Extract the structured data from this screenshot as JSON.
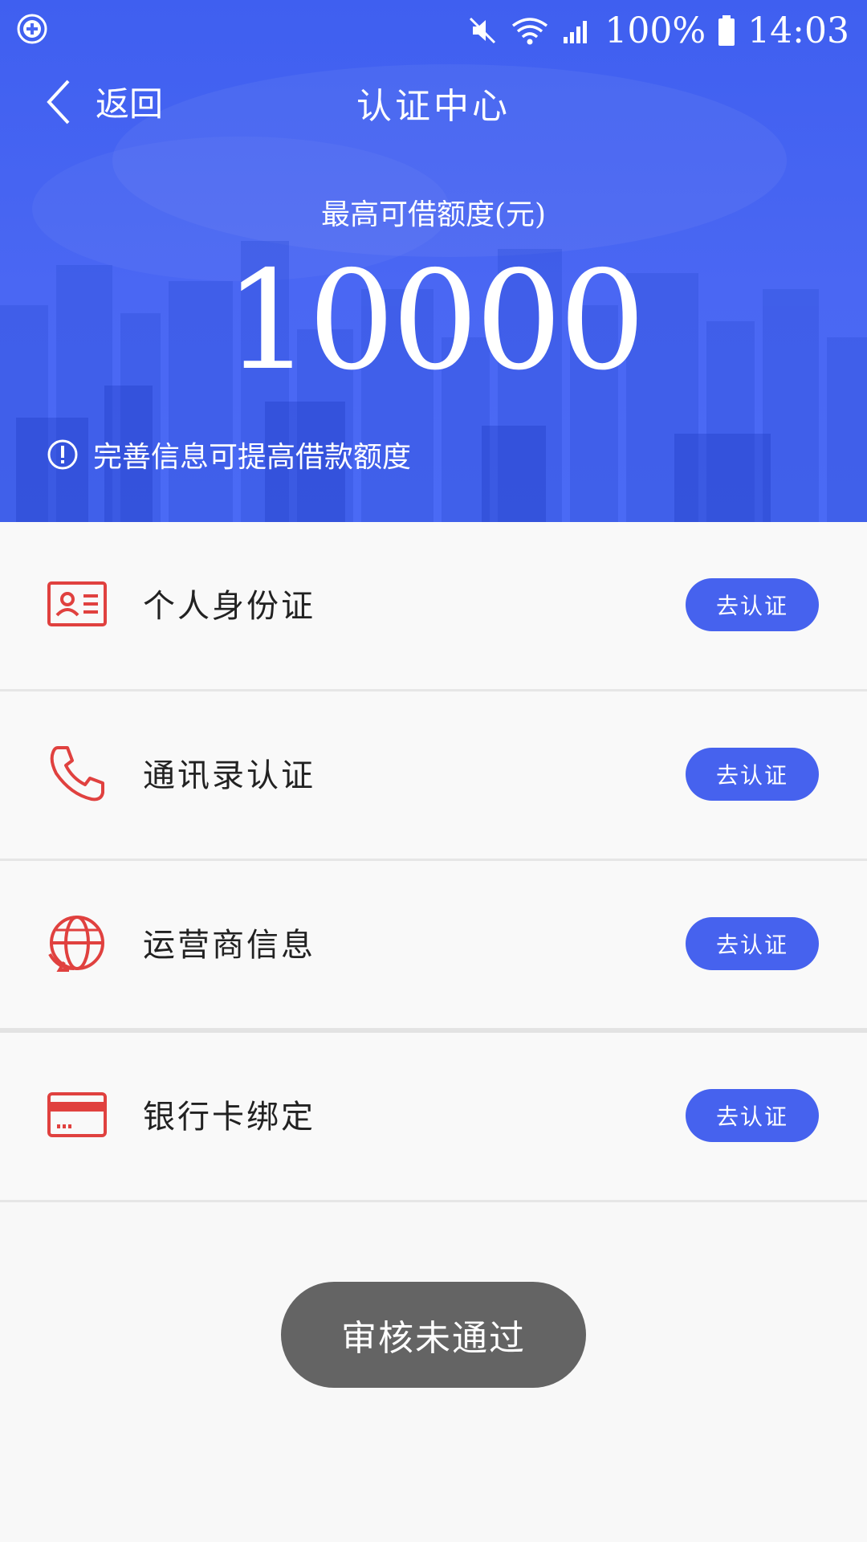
{
  "status_bar": {
    "left_icon": "add-circle-icon",
    "icons": [
      "mute-icon",
      "wifi-icon",
      "signal-icon",
      "battery-icon"
    ],
    "battery": "100%",
    "time": "14:03"
  },
  "nav": {
    "back_label": "返回",
    "title": "认证中心"
  },
  "limit": {
    "label": "最高可借额度(元)",
    "value": "10000"
  },
  "tip": "完善信息可提高借款额度",
  "items": [
    {
      "label": "个人身份证",
      "button": "去认证",
      "icon": "id-card-icon"
    },
    {
      "label": "通讯录认证",
      "button": "去认证",
      "icon": "phone-icon"
    },
    {
      "label": "运营商信息",
      "button": "去认证",
      "icon": "globe-icon"
    },
    {
      "label": "银行卡绑定",
      "button": "去认证",
      "icon": "bank-card-icon"
    }
  ],
  "toast": "审核未通过",
  "colors": {
    "accent": "#4662ee",
    "icon_red": "#e0413f",
    "header": "#4a67f3",
    "toast": "#646464"
  }
}
